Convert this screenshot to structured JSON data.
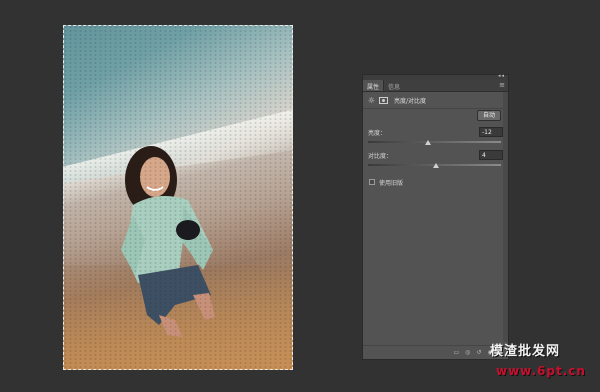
{
  "panel": {
    "tabs": [
      {
        "label": "属性",
        "active": true
      },
      {
        "label": "信息",
        "active": false
      }
    ],
    "collapse_glyph": "◂◂",
    "menu_glyph": "≡",
    "adjustment_title": "亮度/对比度",
    "auto_button": "自动",
    "controls": [
      {
        "label": "亮度：",
        "value": "-12",
        "slider_fraction": 0.45
      },
      {
        "label": "对比度：",
        "value": "4",
        "slider_fraction": 0.51
      }
    ],
    "use_legacy_label": "使用旧版",
    "use_legacy_checked": false
  },
  "bottom_icons": [
    "clip-to-layer-icon",
    "view-previous-icon",
    "reset-icon",
    "visibility-icon",
    "trash-icon"
  ],
  "watermark": {
    "main": "模渣批发网",
    "url": "www.6pt.cn"
  },
  "colors": {
    "app_background": "#323232",
    "panel_background": "#535353",
    "watermark_red": "#c8102e"
  }
}
